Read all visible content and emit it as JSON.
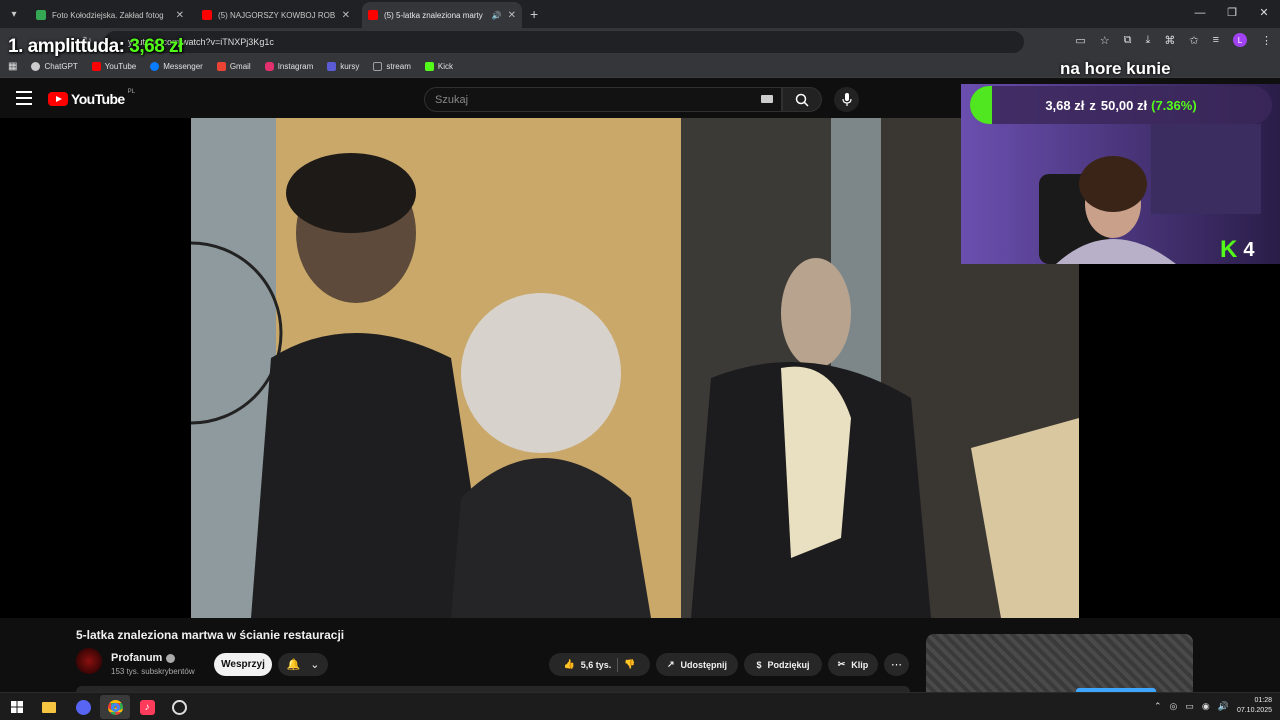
{
  "browser": {
    "tabs": [
      {
        "title": "Foto Kołodziejska. Zakład fotog",
        "favicon_color": "#34a853",
        "active": false,
        "audio": false
      },
      {
        "title": "(5) NAJGORSZY KOWBOJ ROB",
        "favicon_color": "#ff0000",
        "active": false,
        "audio": false
      },
      {
        "title": "(5) 5-latka znaleziona marty",
        "favicon_color": "#ff0000",
        "active": true,
        "audio": true
      }
    ],
    "url": "youtube.com/watch?v=iTNXPj3Kg1c",
    "profile_initial": "L",
    "bookmarks": [
      {
        "label": "ChatGPT",
        "icon": "chatgpt-icon",
        "color": "#cccccc"
      },
      {
        "label": "YouTube",
        "icon": "youtube-icon",
        "color": "#ff0000"
      },
      {
        "label": "Messenger",
        "icon": "messenger-icon",
        "color": "#0a7cff"
      },
      {
        "label": "Gmail",
        "icon": "gmail-icon",
        "color": "#ea4335"
      },
      {
        "label": "Instagram",
        "icon": "instagram-icon",
        "color": "#e1306c"
      },
      {
        "label": "kursy",
        "icon": "notion-icon",
        "color": "#5b5bd6"
      },
      {
        "label": "stream",
        "icon": "folder-icon",
        "color": "#9aa0a6"
      },
      {
        "label": "Kick",
        "icon": "kick-icon",
        "color": "#53fc18"
      }
    ]
  },
  "overlay": {
    "amp_label": "1. amplittuda:",
    "amp_amount": "3,68 zł",
    "top_text": "na hore kunie",
    "goal_current": "3,68 zł",
    "goal_connector": "z",
    "goal_target": "50,00 zł",
    "goal_percent": "(7.36%)",
    "goal_fraction": 0.0736,
    "kick_count": "4"
  },
  "youtube": {
    "logo_text": "YouTube",
    "region": "PL",
    "search_placeholder": "Szukaj",
    "video_title": "5-latka znaleziona martwa w ścianie restauracji",
    "channel_name": "Profanum",
    "subscribers": "153 tys. subskrybentów",
    "support_label": "Wesprzyj",
    "likes": "5,6 tys.",
    "share_label": "Udostępnij",
    "thanks_label": "Podziękuj",
    "clip_label": "Klip"
  },
  "taskbar": {
    "time": "01:28",
    "date": "07.10.2025"
  },
  "colors": {
    "kick_green": "#53fc18",
    "youtube_red": "#ff0000"
  }
}
